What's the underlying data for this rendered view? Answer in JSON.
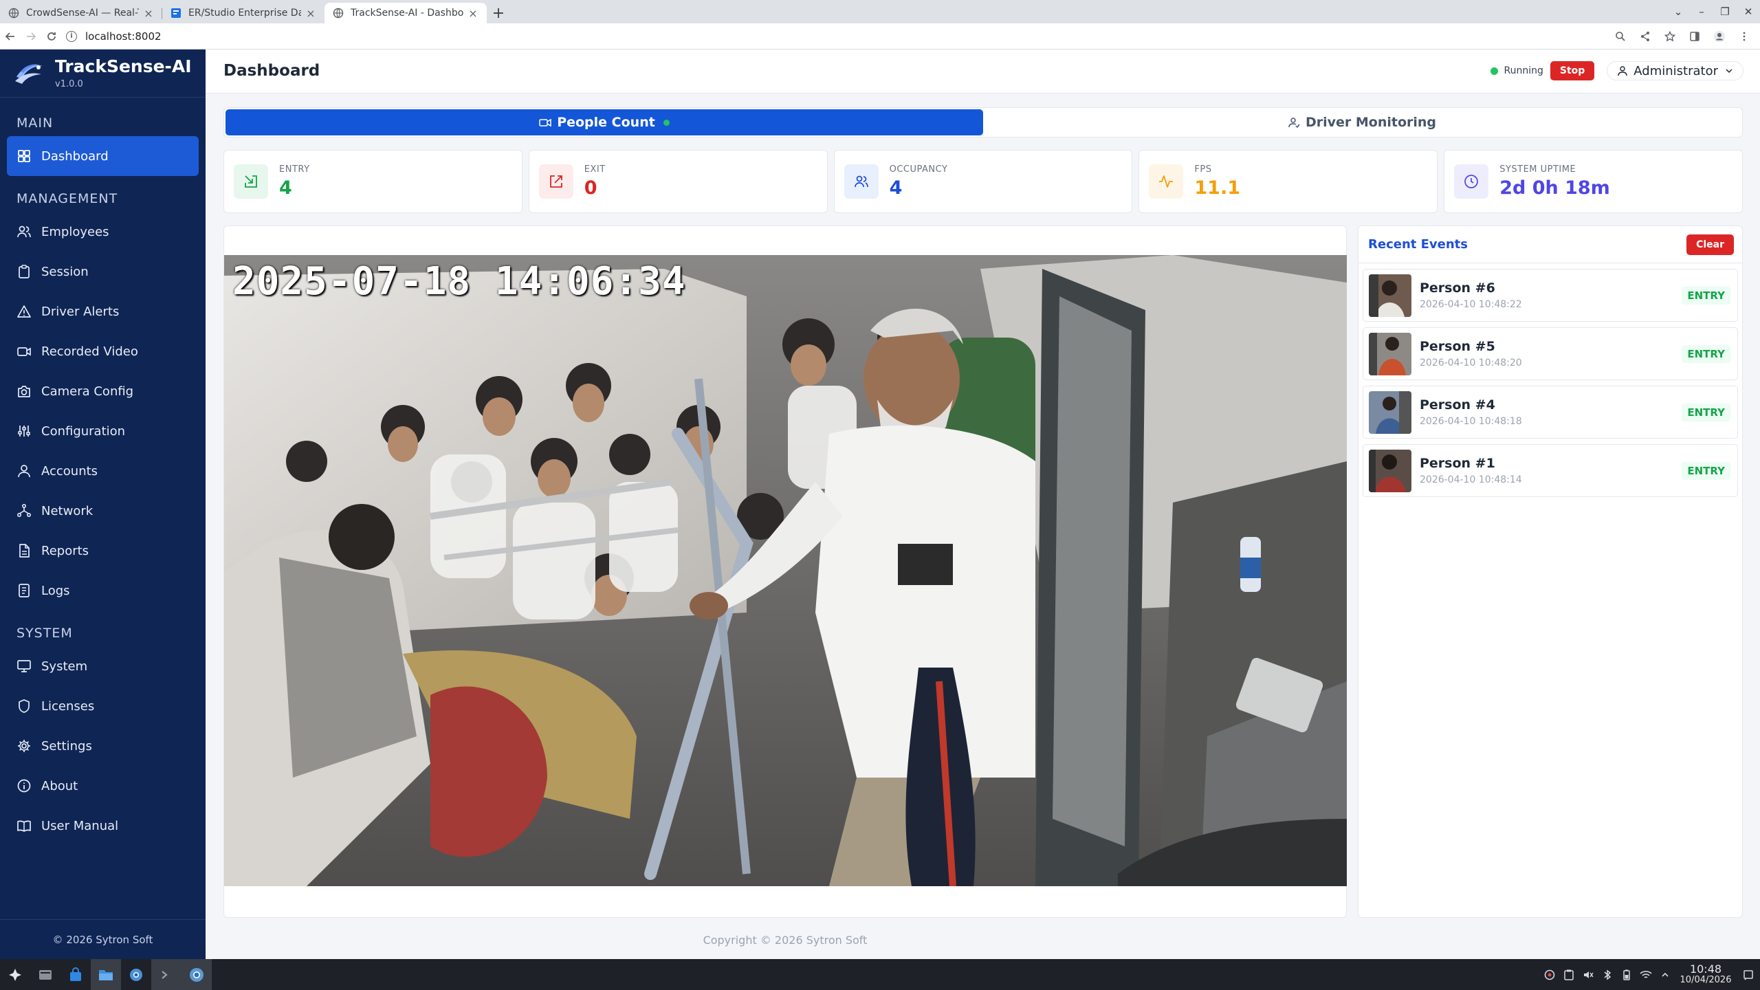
{
  "browser": {
    "tabs": [
      {
        "title": "CrowdSense-AI — Real-Tim",
        "active": false
      },
      {
        "title": "ER/Studio Enterprise Data",
        "active": false
      },
      {
        "title": "TrackSense-AI - Dashboard",
        "active": true
      }
    ],
    "url": "localhost:8002"
  },
  "brand": {
    "name": "TrackSense-AI",
    "version": "v1.0.0"
  },
  "sidebar": {
    "sections": [
      {
        "title": "MAIN",
        "items": [
          {
            "label": "Dashboard",
            "icon": "grid-icon",
            "active": true
          }
        ]
      },
      {
        "title": "MANAGEMENT",
        "items": [
          {
            "label": "Employees",
            "icon": "users-icon"
          },
          {
            "label": "Session",
            "icon": "clipboard-icon"
          },
          {
            "label": "Driver Alerts",
            "icon": "alert-triangle-icon"
          },
          {
            "label": "Recorded Video",
            "icon": "video-icon"
          },
          {
            "label": "Camera Config",
            "icon": "camera-icon"
          },
          {
            "label": "Configuration",
            "icon": "sliders-icon"
          },
          {
            "label": "Accounts",
            "icon": "user-icon"
          },
          {
            "label": "Network",
            "icon": "network-icon"
          },
          {
            "label": "Reports",
            "icon": "file-icon"
          },
          {
            "label": "Logs",
            "icon": "log-icon"
          }
        ]
      },
      {
        "title": "SYSTEM",
        "items": [
          {
            "label": "System",
            "icon": "monitor-icon"
          },
          {
            "label": "Licenses",
            "icon": "shield-icon"
          },
          {
            "label": "Settings",
            "icon": "gear-icon"
          },
          {
            "label": "About",
            "icon": "info-icon"
          },
          {
            "label": "User Manual",
            "icon": "book-icon"
          }
        ]
      }
    ],
    "footer": "© 2026 Sytron Soft"
  },
  "header": {
    "title": "Dashboard",
    "status": "Running",
    "stop_label": "Stop",
    "user": "Administrator"
  },
  "modes": [
    {
      "label": "People Count",
      "active": true
    },
    {
      "label": "Driver Monitoring",
      "active": false
    }
  ],
  "stats": [
    {
      "label": "ENTRY",
      "value": "4",
      "color": "#16a34a",
      "bg": "#e8f7ee",
      "icon": "entry-icon"
    },
    {
      "label": "EXIT",
      "value": "0",
      "color": "#dc2626",
      "bg": "#fdecec",
      "icon": "exit-icon"
    },
    {
      "label": "OCCUPANCY",
      "value": "4",
      "color": "#1d4ed8",
      "bg": "#e8effd",
      "icon": "users-icon"
    },
    {
      "label": "FPS",
      "value": "11.1",
      "color": "#f59e0b",
      "bg": "#fef5e6",
      "icon": "activity-icon"
    },
    {
      "label": "SYSTEM UPTIME",
      "value": "2d 0h 18m",
      "color": "#4f46e5",
      "bg": "#eeedfd",
      "icon": "clock-icon"
    }
  ],
  "video": {
    "timestamp": "2025-07-18 14:06:34"
  },
  "events": {
    "title": "Recent Events",
    "clear_label": "Clear",
    "items": [
      {
        "name": "Person #6",
        "time": "2026-04-10 10:48:22",
        "type": "ENTRY"
      },
      {
        "name": "Person #5",
        "time": "2026-04-10 10:48:20",
        "type": "ENTRY"
      },
      {
        "name": "Person #4",
        "time": "2026-04-10 10:48:18",
        "type": "ENTRY"
      },
      {
        "name": "Person #1",
        "time": "2026-04-10 10:48:14",
        "type": "ENTRY"
      }
    ]
  },
  "footer": {
    "copyright": "Copyright © 2026 Sytron Soft"
  },
  "taskbar": {
    "time": "10:48",
    "date": "10/04/2026"
  },
  "colors": {
    "sidebar_bg": "#0f2554",
    "accent": "#1d5ad6",
    "danger": "#dc2626",
    "success": "#22c55e"
  }
}
